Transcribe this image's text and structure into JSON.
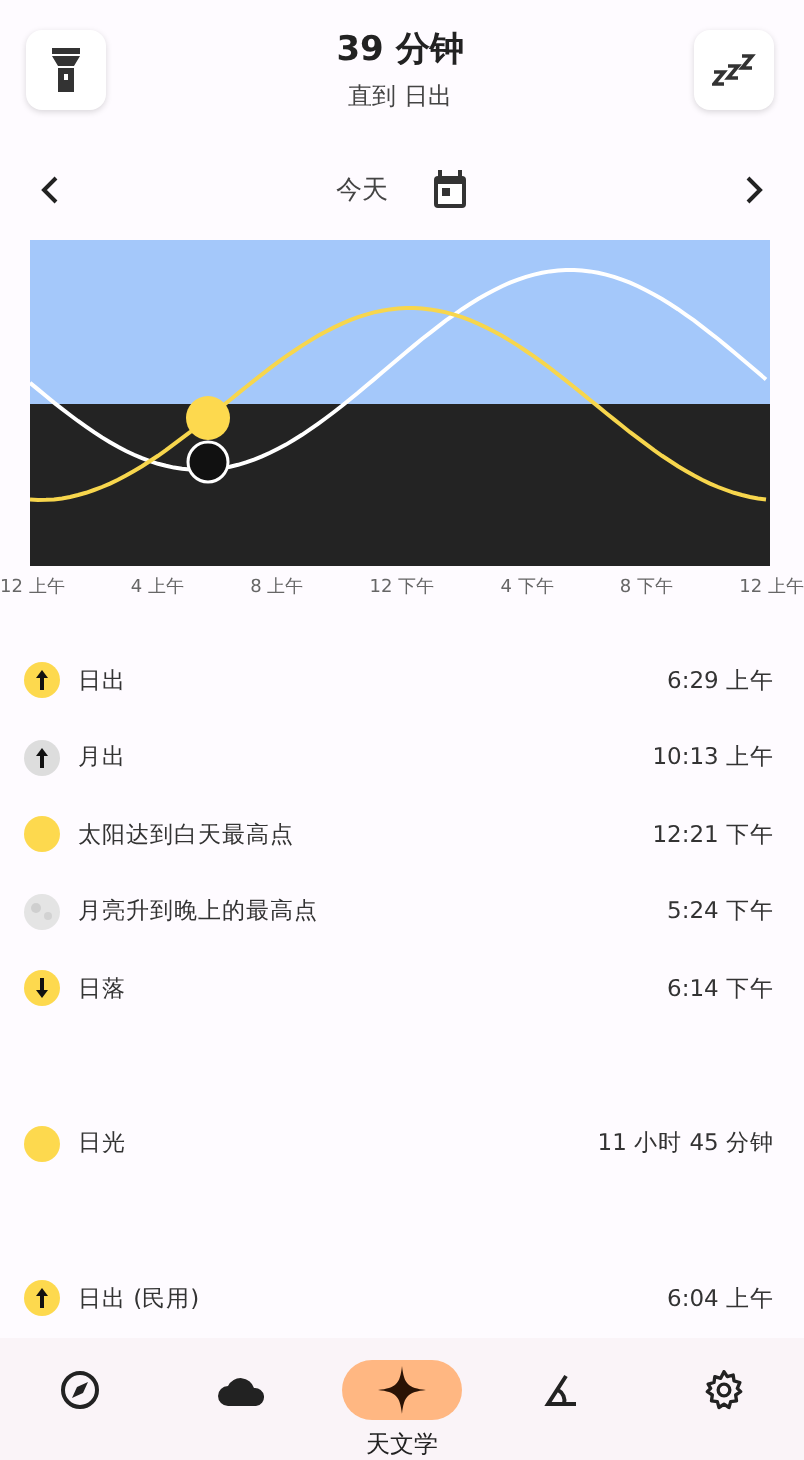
{
  "header": {
    "title": "39 分钟",
    "subtitle": "直到 日出"
  },
  "date_nav": {
    "label": "今天"
  },
  "chart": {
    "x_labels": [
      "12 上午",
      "4 上午",
      "8 上午",
      "12 下午",
      "4 下午",
      "8 下午",
      "12 上午"
    ]
  },
  "groups": [
    [
      {
        "kind": "sun_rise",
        "label": "日出",
        "time": "6:29 上午"
      },
      {
        "kind": "moon_rise",
        "label": "月出",
        "time": "10:13 上午"
      },
      {
        "kind": "sun",
        "label": "太阳达到白天最高点",
        "time": "12:21 下午"
      },
      {
        "kind": "moon",
        "label": "月亮升到晚上的最高点",
        "time": "5:24 下午"
      },
      {
        "kind": "sun_set",
        "label": "日落",
        "time": "6:14 下午"
      }
    ],
    [
      {
        "kind": "sun",
        "label": "日光",
        "time": "11 小时 45 分钟"
      }
    ],
    [
      {
        "kind": "sun_rise",
        "label": "日出 (民用)",
        "time": "6:04 上午"
      }
    ]
  ],
  "bottom_nav": [
    {
      "kind": "compass",
      "selected": false
    },
    {
      "kind": "cloud",
      "selected": false
    },
    {
      "kind": "star",
      "label": "天文学",
      "selected": true
    },
    {
      "kind": "angle",
      "selected": false
    },
    {
      "kind": "gear",
      "selected": false
    }
  ]
}
